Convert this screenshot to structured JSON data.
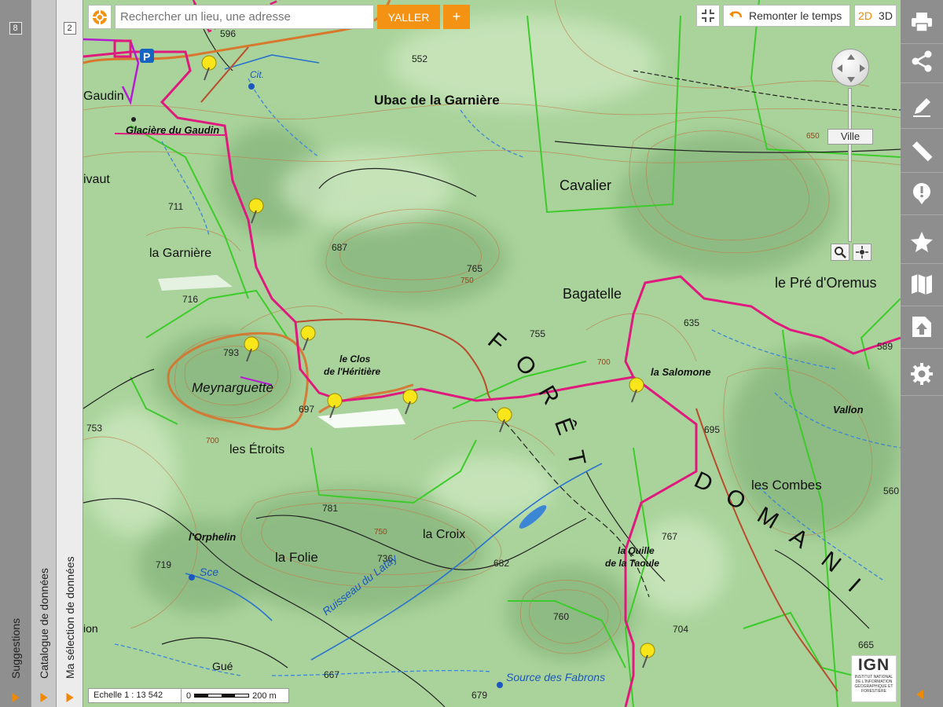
{
  "left_panels": {
    "suggestions": {
      "label": "Suggestions",
      "badge": "8"
    },
    "catalogue": {
      "label": "Catalogue de données"
    },
    "selection": {
      "label": "Ma sélection de données",
      "badge": "2"
    }
  },
  "search": {
    "placeholder": "Rechercher un lieu, une adresse",
    "go_label": "YALLER",
    "plus_label": "+"
  },
  "top_controls": {
    "time_label": "Remonter le temps",
    "view_2d": "2D",
    "view_3d": "3D"
  },
  "zoom": {
    "level_label": "Ville"
  },
  "right_toolbar": {
    "icons": [
      "print-icon",
      "share-icon",
      "pencil-icon",
      "ruler-icon",
      "alert-icon",
      "star-icon",
      "map-icon",
      "upload-icon",
      "gear-icon"
    ]
  },
  "scale": {
    "ratio_text": "Echelle 1 : 13 542",
    "start_label": "0",
    "end_label": "200 m"
  },
  "logo": {
    "name": "IGN",
    "subtitle": "INSTITUT NATIONAL DE L'INFORMATION GÉOGRAPHIQUE ET FORESTIÈRE"
  },
  "map_labels": {
    "altitudes": [
      "596",
      "552",
      "711",
      "687",
      "765",
      "750",
      "716",
      "755",
      "635",
      "589",
      "793",
      "697",
      "700",
      "695",
      "753",
      "700",
      "650",
      "781",
      "750",
      "736",
      "719",
      "682",
      "767",
      "560",
      "760",
      "704",
      "667",
      "679",
      "665"
    ],
    "places": {
      "gaudin": "Gaudin",
      "glaciere": "Glacière du Gaudin",
      "ubac": "Ubac de la Garnière",
      "cavalier": "Cavalier",
      "ivaut": "ivaut",
      "garniere": "la Garnière",
      "bagatelle": "Bagatelle",
      "pre_oremus": "le Pré d'Oremus",
      "clos1": "le Clos",
      "clos2": "de l'Héritière",
      "salomone": "la Salomone",
      "meynarguette": "Meynarguette",
      "etroits": "les Étroits",
      "vallon": "Vallon",
      "combes": "les Combes",
      "orphelin": "l'Orphelin",
      "folie": "la Folie",
      "croix": "la Croix",
      "quille1": "la Quille",
      "quille2": "de la Taoule",
      "gue": "Gué",
      "ion": "ion",
      "cit": "Cit."
    },
    "water": {
      "ruisseau": "Ruisseau du Latay",
      "source": "Source des Fabrons",
      "sce": "Sce"
    },
    "forest_word1": [
      "F",
      "O",
      "R",
      "Ê",
      "T"
    ],
    "forest_word2": [
      "D",
      "O",
      "M",
      "A",
      "N",
      "I"
    ]
  }
}
